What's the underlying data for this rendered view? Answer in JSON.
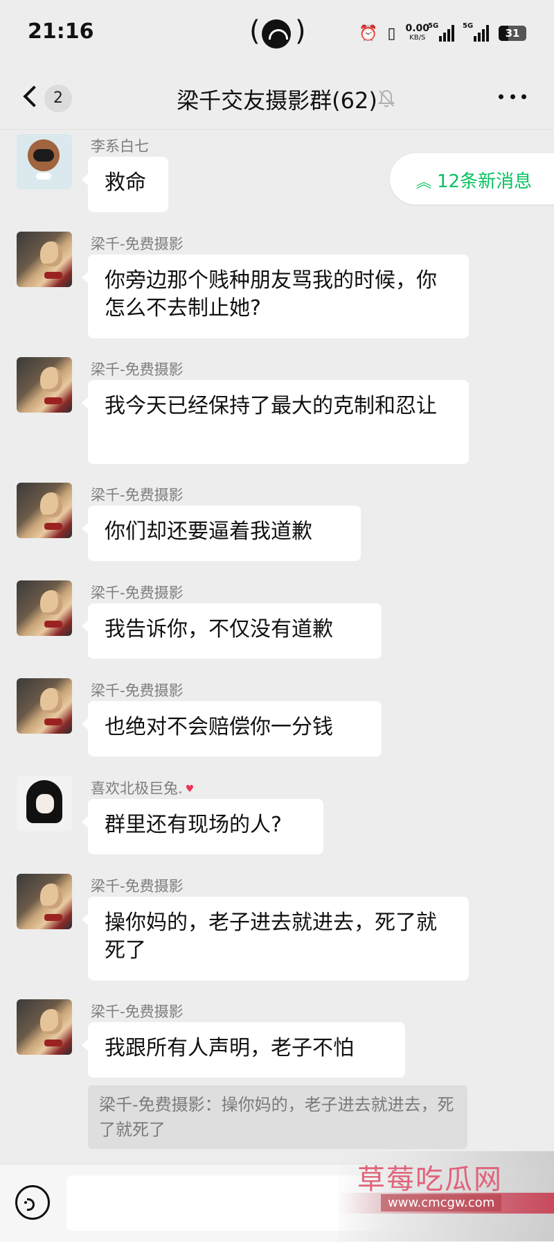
{
  "status_bar": {
    "time": "21:16",
    "net_speed": "0.00",
    "net_unit": "KB/S",
    "sig1": "5G",
    "sig2": "5G",
    "battery": "31"
  },
  "header": {
    "unread": "2",
    "title": "梁千交友摄影群(62)"
  },
  "new_messages": "12条新消息",
  "messages": [
    {
      "sender": "李系白七",
      "text": "救命"
    },
    {
      "sender": "梁千-免费摄影",
      "text": "你旁边那个贱种朋友骂我的时候，你怎么不去制止她?"
    },
    {
      "sender": "梁千-免费摄影",
      "text": "我今天已经保持了最大的克制和忍让"
    },
    {
      "sender": "梁千-免费摄影",
      "text": "你们却还要逼着我道歉"
    },
    {
      "sender": "梁千-免费摄影",
      "text": "我告诉你，不仅没有道歉"
    },
    {
      "sender": "梁千-免费摄影",
      "text": "也绝对不会赔偿你一分钱"
    },
    {
      "sender": "喜欢北极巨兔.",
      "text": "群里还有现场的人?"
    },
    {
      "sender": "梁千-免费摄影",
      "text": "操你妈的，老子进去就进去，死了就死了"
    },
    {
      "sender": "梁千-免费摄影",
      "text": "我跟所有人声明，老子不怕"
    }
  ],
  "quote": "梁千-免费摄影：操你妈的，老子进去就进去，死了就死了",
  "watermark": {
    "text": "草莓吃瓜网",
    "url": "www.cmcgw.com"
  }
}
